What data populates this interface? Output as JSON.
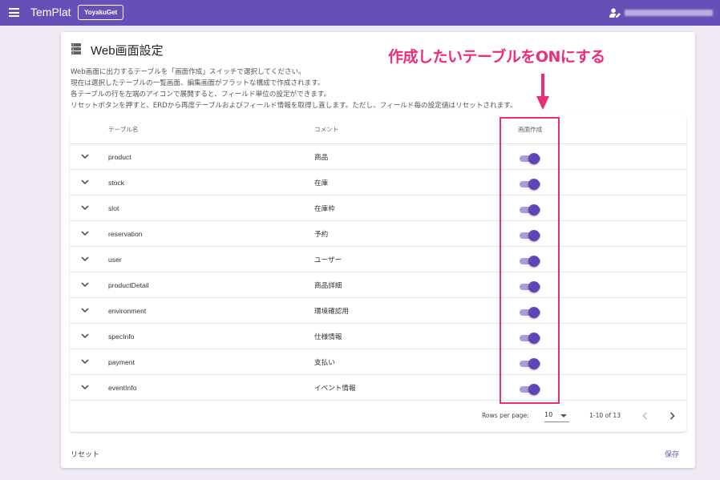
{
  "appbar": {
    "app_title": "TemPlat",
    "project_label": "YoyakuGet",
    "accent_color": "#6650b8",
    "icons": [
      "menu-icon",
      "user-edit-icon"
    ]
  },
  "card": {
    "title": "Web画面設定",
    "title_icon": "database-icon",
    "description": [
      "Web画面に出力するテーブルを「画面作成」スイッチで選択してください。",
      "現在は選択したテーブルの一覧画面、編集画面がフラットな構成で作成されます。",
      "各テーブルの行を左端のアイコンで展開すると、フィールド単位の設定ができます。",
      "リセットボタンを押すと、ERDから再度テーブルおよびフィールド情報を取得し直します。ただし、フィールド毎の設定値はリセットされます。"
    ]
  },
  "table": {
    "headers": {
      "name": "テーブル名",
      "comment": "コメント",
      "create": "画面作成"
    },
    "rows": [
      {
        "name": "product",
        "comment": "商品",
        "create_screen": true
      },
      {
        "name": "stock",
        "comment": "在庫",
        "create_screen": true
      },
      {
        "name": "slot",
        "comment": "在庫枠",
        "create_screen": true
      },
      {
        "name": "reservation",
        "comment": "予約",
        "create_screen": true
      },
      {
        "name": "user",
        "comment": "ユーザー",
        "create_screen": true
      },
      {
        "name": "productDetail",
        "comment": "商品詳細",
        "create_screen": true
      },
      {
        "name": "environment",
        "comment": "環境確認用",
        "create_screen": true
      },
      {
        "name": "specInfo",
        "comment": "仕様情報",
        "create_screen": true
      },
      {
        "name": "payment",
        "comment": "支払い",
        "create_screen": true
      },
      {
        "name": "eventInfo",
        "comment": "イベント情報",
        "create_screen": true
      }
    ],
    "footer": {
      "rows_per_page_label": "Rows per page:",
      "rows_per_page_value": "10",
      "page_range": "1-10 of 13"
    }
  },
  "actions": {
    "reset_label": "リセット",
    "save_label": "保存"
  },
  "annotation": {
    "text": "作成したいテーブルをONにする",
    "color": "#ec2d7a"
  },
  "toggle_colors": {
    "track": "#a999de",
    "thumb": "#5b46b3"
  }
}
